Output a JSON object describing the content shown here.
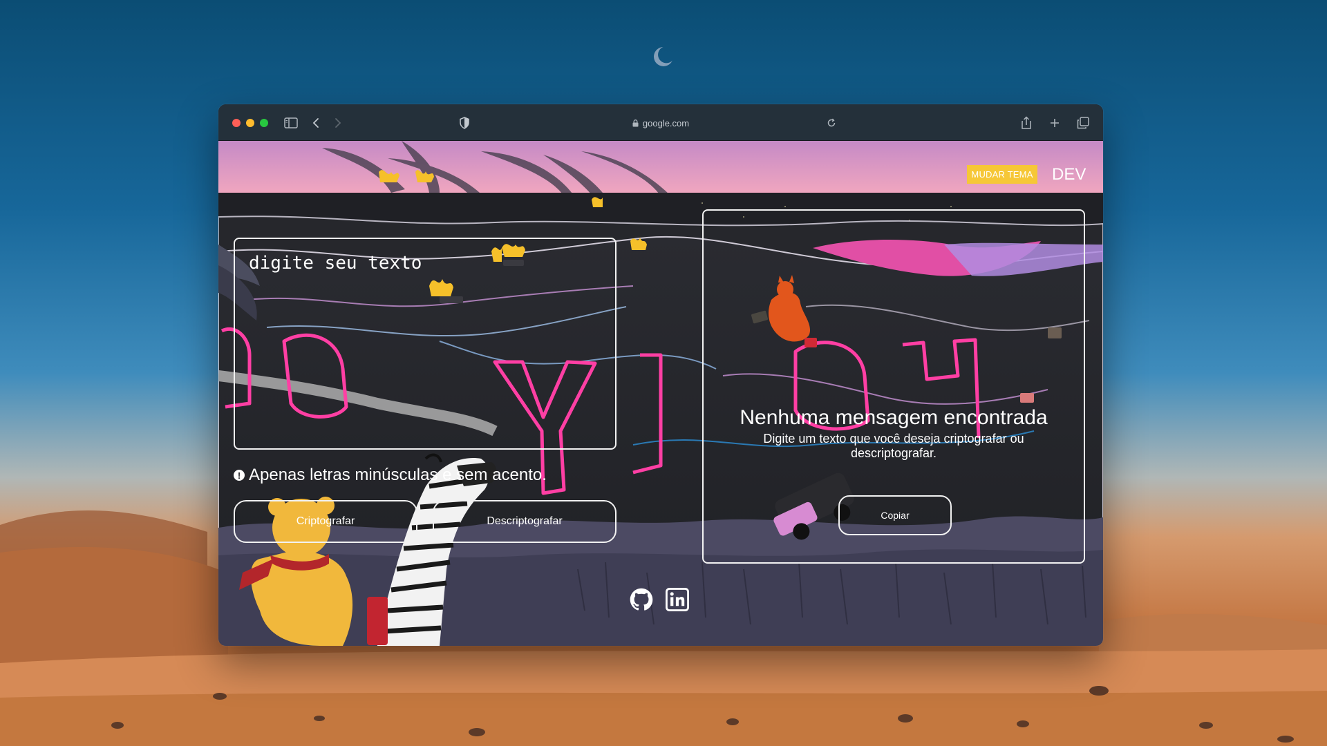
{
  "browser": {
    "url": "google.com",
    "icons": [
      "sidebar-icon",
      "back-icon",
      "forward-icon",
      "shield-icon",
      "lock-icon",
      "reload-icon",
      "share-icon",
      "new-tab-icon",
      "tabs-overview-icon"
    ]
  },
  "header": {
    "theme_button": "MUDAR TEMA",
    "brand": "DEV"
  },
  "encoder": {
    "input_placeholder": "digite seu texto",
    "hint": "Apenas letras minúsculas e sem acento.",
    "encrypt_button": "Criptografar",
    "decrypt_button": "Descriptografar"
  },
  "output": {
    "title": "Nenhuma mensagem encontrada",
    "subtitle": "Digite um texto que você deseja criptografar ou descriptografar.",
    "copy_button": "Copiar"
  },
  "footer": {
    "icons": [
      "github-icon",
      "linkedin-icon"
    ]
  },
  "colors": {
    "accent": "#f6c737",
    "text": "#ffffff",
    "border": "#f2f2f2",
    "neon": "#ff3fa4",
    "sky_pink": "#d98fc4"
  }
}
